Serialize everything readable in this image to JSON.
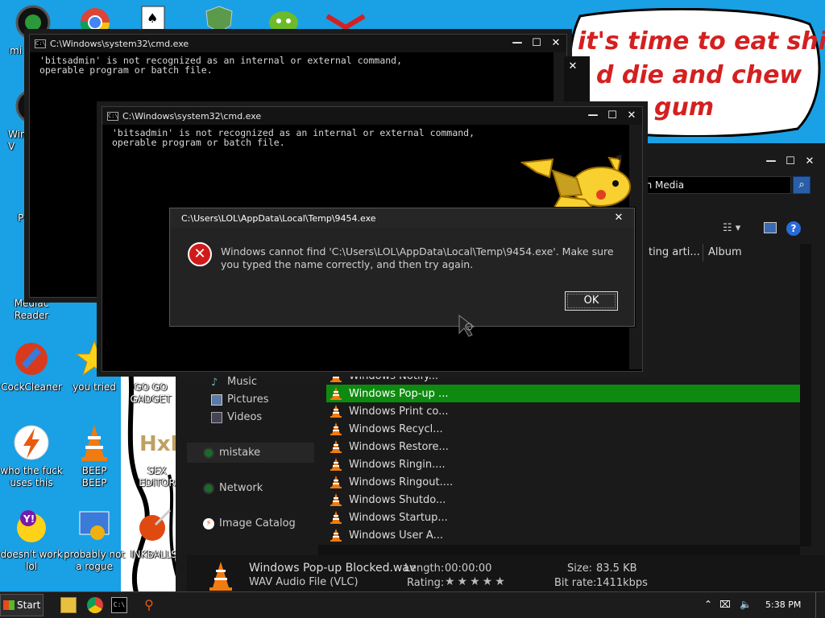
{
  "bubble": {
    "line1": "it's time to eat shit",
    "line2": "d die and chew",
    "line3": "gum"
  },
  "desktop_icons": [
    {
      "label": "mi"
    },
    {
      "label": "Win\nV"
    },
    {
      "label": "P"
    },
    {
      "label": "Mediac\nReader"
    },
    {
      "label": "CockCleaner"
    },
    {
      "label": "you tried"
    },
    {
      "label": "GO GO\nGADGET"
    },
    {
      "label": "who the fuck\nuses this"
    },
    {
      "label": "BEEP\nBEEP"
    },
    {
      "label": "SEX\nEDITOR"
    },
    {
      "label": "doesn't work\nlol"
    },
    {
      "label": "probably not\na rogue"
    },
    {
      "label": "INKBALLS"
    }
  ],
  "cmd1": {
    "title": "C:\\Windows\\system32\\cmd.exe",
    "output": "'bitsadmin' is not recognized as an internal or external command,\noperable program or batch file."
  },
  "cmd2": {
    "title": "C:\\Windows\\system32\\cmd.exe",
    "output": "'bitsadmin' is not recognized as an internal or external command,\noperable program or batch file."
  },
  "explorer": {
    "search_value": "ch Media",
    "columns": [
      "ating arti...",
      "Album"
    ],
    "nav": [
      "Music",
      "Pictures",
      "Videos",
      "mistake",
      "Network",
      "Image Catalog"
    ],
    "files": [
      {
        "name": "Windows Notify...",
        "selected": false
      },
      {
        "name": "Windows Pop-up ...",
        "selected": true
      },
      {
        "name": "Windows Print co...",
        "selected": false
      },
      {
        "name": "Windows Recycl...",
        "selected": false
      },
      {
        "name": "Windows Restore...",
        "selected": false
      },
      {
        "name": "Windows Ringin....",
        "selected": false
      },
      {
        "name": "Windows Ringout....",
        "selected": false
      },
      {
        "name": "Windows Shutdo...",
        "selected": false
      },
      {
        "name": "Windows Startup...",
        "selected": false
      },
      {
        "name": "Windows User A...",
        "selected": false
      }
    ],
    "details": {
      "filename": "Windows Pop-up Blocked.wav",
      "filetype": "WAV Audio File (VLC)",
      "length_label": "Length:",
      "length": "00:00:00",
      "rating_label": "Rating:",
      "rating": "★★★★★",
      "size_label": "Size:",
      "size": "83.5 KB",
      "bitrate_label": "Bit rate:",
      "bitrate": "1411kbps"
    }
  },
  "error": {
    "title": "C:\\Users\\LOL\\AppData\\Local\\Temp\\9454.exe",
    "message": "Windows cannot find 'C:\\Users\\LOL\\AppData\\Local\\Temp\\9454.exe'. Make sure you typed the name correctly, and then try again.",
    "ok_label": "OK"
  },
  "taskbar": {
    "start_label": "Start",
    "time": "5:38 PM"
  },
  "colors": {
    "desktop": "#1aa0e4",
    "selection": "#0f8a10",
    "error_red": "#d01a1a"
  }
}
